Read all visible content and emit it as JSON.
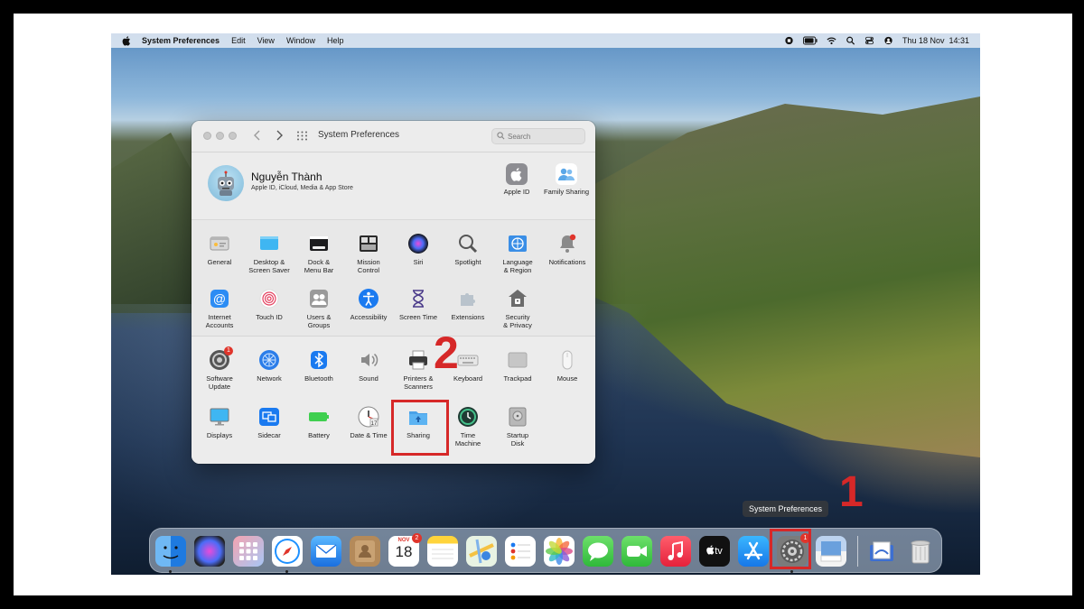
{
  "menubar": {
    "app_name": "System Preferences",
    "items": [
      "Edit",
      "View",
      "Window",
      "Help"
    ],
    "battery_icon": "battery-charging-icon",
    "date_time": "Thu 18 Nov  14:31"
  },
  "window": {
    "title": "System Preferences",
    "search_placeholder": "Search"
  },
  "account": {
    "name": "Nguyễn Thành",
    "subtitle": "Apple ID, iCloud, Media & App Store",
    "items": [
      {
        "label": "Apple ID",
        "icon": "apple-id-icon"
      },
      {
        "label": "Family Sharing",
        "icon": "family-sharing-icon"
      }
    ]
  },
  "prefs_row1": [
    {
      "label": "General",
      "icon": "general-icon"
    },
    {
      "label": "Desktop &\nScreen Saver",
      "icon": "desktop-screensaver-icon"
    },
    {
      "label": "Dock &\nMenu Bar",
      "icon": "dock-menubar-icon"
    },
    {
      "label": "Mission\nControl",
      "icon": "mission-control-icon"
    },
    {
      "label": "Siri",
      "icon": "siri-icon"
    },
    {
      "label": "Spotlight",
      "icon": "spotlight-icon"
    },
    {
      "label": "Language\n& Region",
      "icon": "language-region-icon"
    },
    {
      "label": "Notifications",
      "icon": "notifications-icon"
    }
  ],
  "prefs_row2": [
    {
      "label": "Internet\nAccounts",
      "icon": "internet-accounts-icon"
    },
    {
      "label": "Touch ID",
      "icon": "touch-id-icon"
    },
    {
      "label": "Users &\nGroups",
      "icon": "users-groups-icon"
    },
    {
      "label": "Accessibility",
      "icon": "accessibility-icon"
    },
    {
      "label": "Screen Time",
      "icon": "screen-time-icon"
    },
    {
      "label": "Extensions",
      "icon": "extensions-icon"
    },
    {
      "label": "Security\n& Privacy",
      "icon": "security-privacy-icon"
    }
  ],
  "prefs_row3": [
    {
      "label": "Software\nUpdate",
      "icon": "software-update-icon",
      "badge": "1"
    },
    {
      "label": "Network",
      "icon": "network-icon"
    },
    {
      "label": "Bluetooth",
      "icon": "bluetooth-icon"
    },
    {
      "label": "Sound",
      "icon": "sound-icon"
    },
    {
      "label": "Printers &\nScanners",
      "icon": "printers-scanners-icon"
    },
    {
      "label": "Keyboard",
      "icon": "keyboard-icon"
    },
    {
      "label": "Trackpad",
      "icon": "trackpad-icon"
    },
    {
      "label": "Mouse",
      "icon": "mouse-icon"
    }
  ],
  "prefs_row4": [
    {
      "label": "Displays",
      "icon": "displays-icon"
    },
    {
      "label": "Sidecar",
      "icon": "sidecar-icon"
    },
    {
      "label": "Battery",
      "icon": "battery-icon"
    },
    {
      "label": "Date & Time",
      "icon": "date-time-icon"
    },
    {
      "label": "Sharing",
      "icon": "sharing-icon"
    },
    {
      "label": "Time\nMachine",
      "icon": "time-machine-icon"
    },
    {
      "label": "Startup\nDisk",
      "icon": "startup-disk-icon"
    }
  ],
  "annotations": {
    "step1": "1",
    "step2": "2"
  },
  "dock": {
    "tooltip": "System Preferences",
    "calendar_month": "NOV",
    "calendar_day": "18",
    "calendar_badge": "2",
    "sysprefs_badge": "1",
    "tv_label": "tv"
  },
  "colors": {
    "highlight": "#d62828",
    "badge": "#e0352b"
  }
}
